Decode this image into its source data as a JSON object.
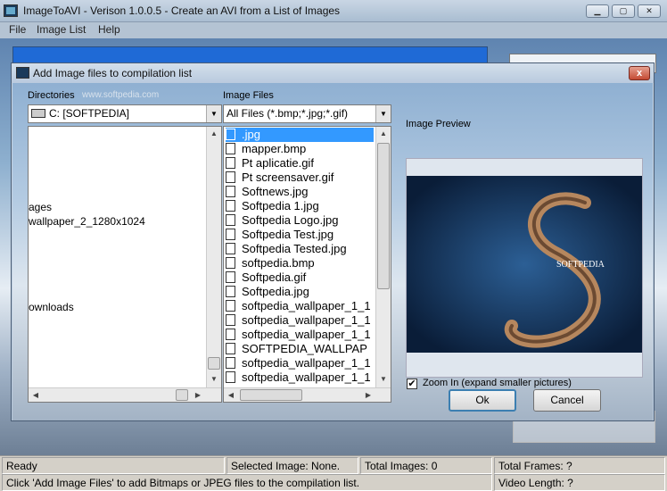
{
  "main": {
    "title": "ImageToAVI - Verison 1.0.0.5 - Create an AVI from a List of Images",
    "menu": [
      "File",
      "Image List",
      "Help"
    ],
    "window_buttons": {
      "minimize": "▁",
      "maximize": "▢",
      "close": "✕"
    }
  },
  "dialog": {
    "title": "Add Image files to compilation list",
    "close_glyph": "x",
    "directories_label": "Directories",
    "watermark": "www.softpedia.com",
    "drive_value": "C: [SOFTPEDIA]",
    "dir_items": [
      "ages",
      "wallpaper_2_1280x1024",
      "ownloads"
    ],
    "image_files_label": "Image Files",
    "filter_value": "All Files (*.bmp;*.jpg;*.gif)",
    "files": [
      ".jpg",
      "mapper.bmp",
      "Pt aplicatie.gif",
      "Pt screensaver.gif",
      "Softnews.jpg",
      "Softpedia 1.jpg",
      "Softpedia Logo.jpg",
      "Softpedia Test.jpg",
      "Softpedia Tested.jpg",
      "softpedia.bmp",
      "Softpedia.gif",
      "Softpedia.jpg",
      "softpedia_wallpaper_1_1",
      "softpedia_wallpaper_1_1",
      "softpedia_wallpaper_1_1",
      "SOFTPEDIA_WALLPAP",
      "softpedia_wallpaper_1_1",
      "softpedia_wallpaper_1_1"
    ],
    "selected_file_index": 0,
    "preview_label": "Image Preview",
    "preview_logo_text": "SOFTPEDIA",
    "zoom_label": "Zoom In (expand smaller pictures)",
    "zoom_checked": true,
    "ok_label": "Ok",
    "cancel_label": "Cancel"
  },
  "status": {
    "ready": "Ready",
    "selected_image": "Selected Image: None.",
    "total_images": "Total Images: 0",
    "total_frames": "Total Frames: ?",
    "hint": "Click 'Add Image Files' to add Bitmaps or JPEG files to the compilation list.",
    "video_length": "Video Length: ?"
  },
  "colors": {
    "selection": "#3399ff",
    "title_bar": "#b9cade",
    "close_button": "#c44a33"
  },
  "icons": {
    "file": "file-icon",
    "drive": "drive-icon",
    "checkbox": "checkbox-checked-icon"
  }
}
